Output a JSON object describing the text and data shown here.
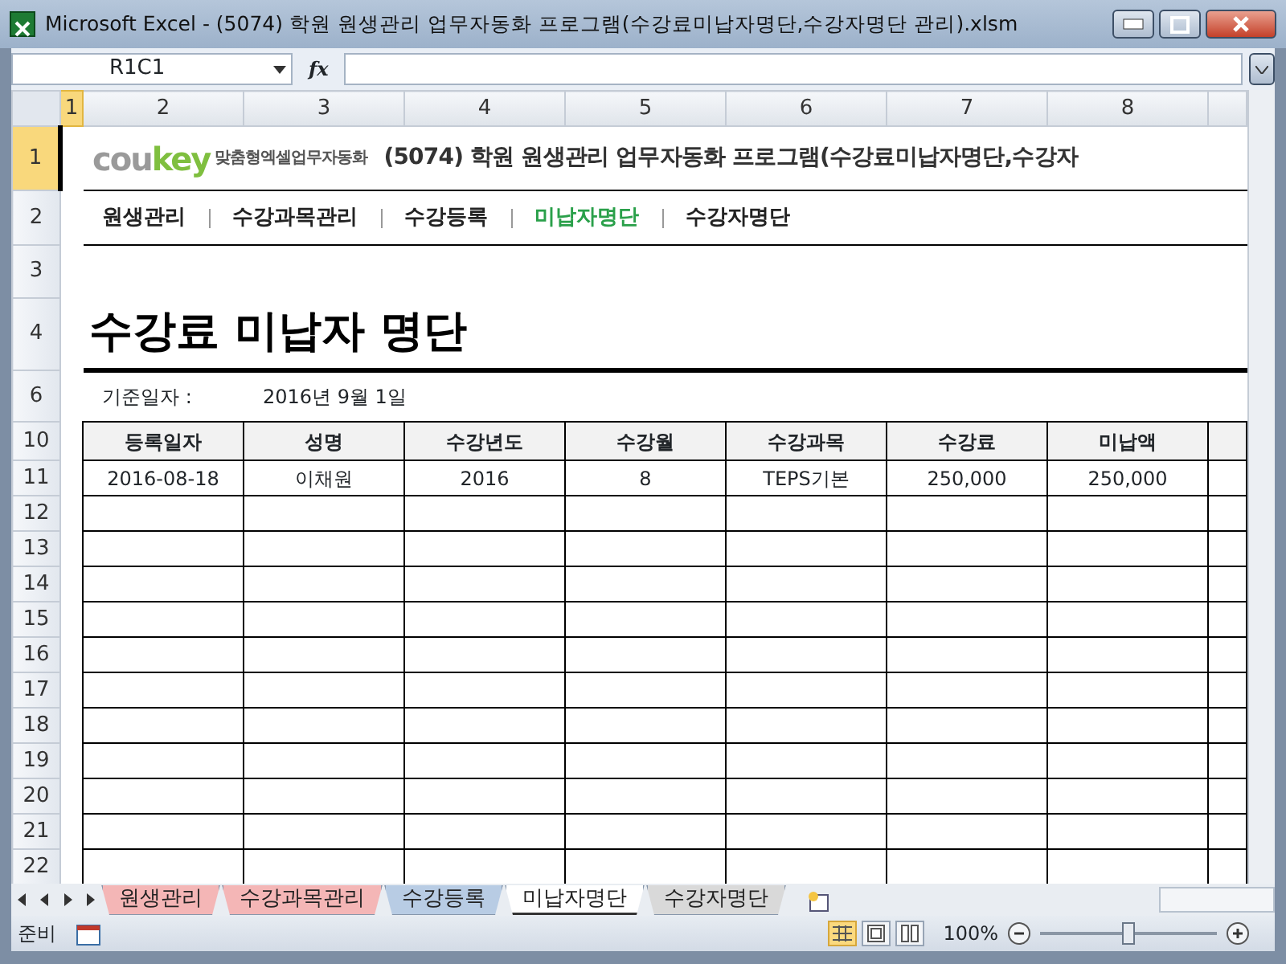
{
  "window": {
    "title": "Microsoft Excel - (5074) 학원 원생관리 업무자동화 프로그램(수강료미납자명단,수강자명단 관리).xlsm"
  },
  "formula_bar": {
    "name_box": "R1C1",
    "fx": "fx"
  },
  "column_headers": [
    {
      "label": "1",
      "selected": true
    },
    {
      "label": "2",
      "selected": false
    },
    {
      "label": "3",
      "selected": false
    },
    {
      "label": "4",
      "selected": false
    },
    {
      "label": "5",
      "selected": false
    },
    {
      "label": "6",
      "selected": false
    },
    {
      "label": "7",
      "selected": false
    },
    {
      "label": "8",
      "selected": false
    }
  ],
  "sheet": {
    "logo": {
      "part_1": "cou",
      "part_2": "key",
      "tagline": "맞춤형엑셀업무자동화"
    },
    "program_title": "(5074) 학원 원생관리 업무자동화 프로그램(수강료미납자명단,수강자",
    "nav": [
      {
        "label": "원생관리",
        "selected": false
      },
      {
        "label": "수강과목관리",
        "selected": false
      },
      {
        "label": "수강등록",
        "selected": false
      },
      {
        "label": "미납자명단",
        "selected": true
      },
      {
        "label": "수강자명단",
        "selected": false
      }
    ],
    "page_title": "수강료 미납자 명단",
    "base_date": {
      "label": "기준일자 :",
      "value": "2016년 9월 1일"
    },
    "row_numbers": {
      "logo": "1",
      "nav": "2",
      "blank": "3",
      "title": "4",
      "date": "6",
      "header": "10"
    },
    "table": {
      "columns": [
        "등록일자",
        "성명",
        "수강년도",
        "수강월",
        "수강과목",
        "수강료",
        "미납액"
      ],
      "rows": [
        {
          "row_number": "11",
          "cells": [
            "2016-08-18",
            "이채원",
            "2016",
            "8",
            "TEPS기본",
            "250,000",
            "250,000"
          ]
        },
        {
          "row_number": "12",
          "cells": []
        },
        {
          "row_number": "13",
          "cells": []
        },
        {
          "row_number": "14",
          "cells": []
        },
        {
          "row_number": "15",
          "cells": []
        },
        {
          "row_number": "16",
          "cells": []
        },
        {
          "row_number": "17",
          "cells": []
        },
        {
          "row_number": "18",
          "cells": []
        },
        {
          "row_number": "19",
          "cells": []
        },
        {
          "row_number": "20",
          "cells": []
        },
        {
          "row_number": "21",
          "cells": []
        },
        {
          "row_number": "22",
          "cells": []
        }
      ]
    }
  },
  "sheet_tabs": [
    {
      "label": "원생관리",
      "selected": false,
      "color": "#f4b6b6"
    },
    {
      "label": "수강과목관리",
      "selected": false,
      "color": "#f4b6b6"
    },
    {
      "label": "수강등록",
      "selected": false,
      "color": "#b8cce4"
    },
    {
      "label": "미납자명단",
      "selected": true,
      "color": "#ffffff"
    },
    {
      "label": "수강자명단",
      "selected": false,
      "color": "#d9d9d9"
    }
  ],
  "status_bar": {
    "mode": "준비",
    "views": [
      {
        "kind": "normal",
        "selected": true
      },
      {
        "kind": "layout",
        "selected": false
      },
      {
        "kind": "pagebreak",
        "selected": false
      }
    ],
    "zoom": "100%",
    "zoom_slider": {
      "level": 0.5
    }
  }
}
